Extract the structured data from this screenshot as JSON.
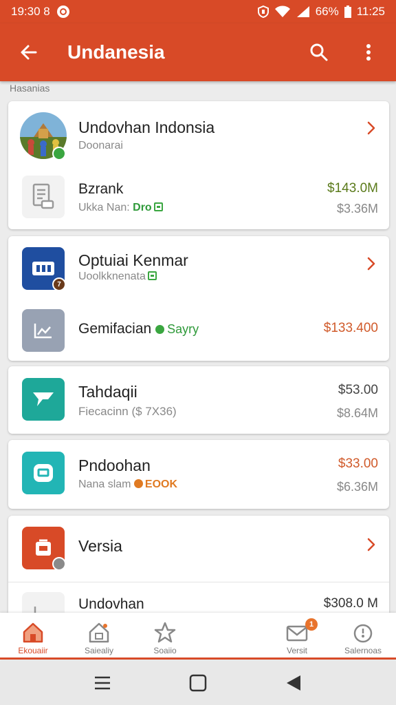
{
  "status_bar": {
    "time_left": "19:30 8",
    "battery": "66%",
    "time_right": "11:25"
  },
  "app_bar": {
    "title": "Undanesia"
  },
  "section_label": "Hasanias",
  "cards": [
    {
      "title": "Undovhan Indonsia",
      "subtitle": "Doonarai",
      "sub_item": {
        "title": "Bzrank",
        "subtitle": "Ukka Nan: ",
        "tag": "Dro",
        "price": "$143.0M",
        "price_sub": "$3.36M"
      }
    },
    {
      "title": "Optuiai Kenmar",
      "subtitle": "Uoolkknenata",
      "badge": "7",
      "sub_item": {
        "title": "Gemifacian",
        "tag": "Sayry",
        "price": "$133.400"
      }
    },
    {
      "title": "Tahdaqii",
      "subtitle": "Fiecacinn ($ 7X36)",
      "price": "$53.00",
      "price_sub": "$8.64M"
    },
    {
      "title": "Pndoohan",
      "subtitle": "Nana slam ",
      "tag": "EOOK",
      "price": "$33.00",
      "price_sub": "$6.36M"
    },
    {
      "title": "Versia",
      "sub_title": "Undovhan",
      "sub_price": "$308.0 M"
    }
  ],
  "bottom_nav": [
    {
      "label": "Ekouaiir"
    },
    {
      "label": "Saiealiy"
    },
    {
      "label": "Soaiio"
    },
    {
      "label": "Versit",
      "badge": "1"
    },
    {
      "label": "Salernoas"
    }
  ],
  "colors": {
    "primary": "#d84a27",
    "price_green": "#5a7a1a",
    "price_orange": "#d05a2a",
    "tag_green": "#2f9a3a"
  }
}
